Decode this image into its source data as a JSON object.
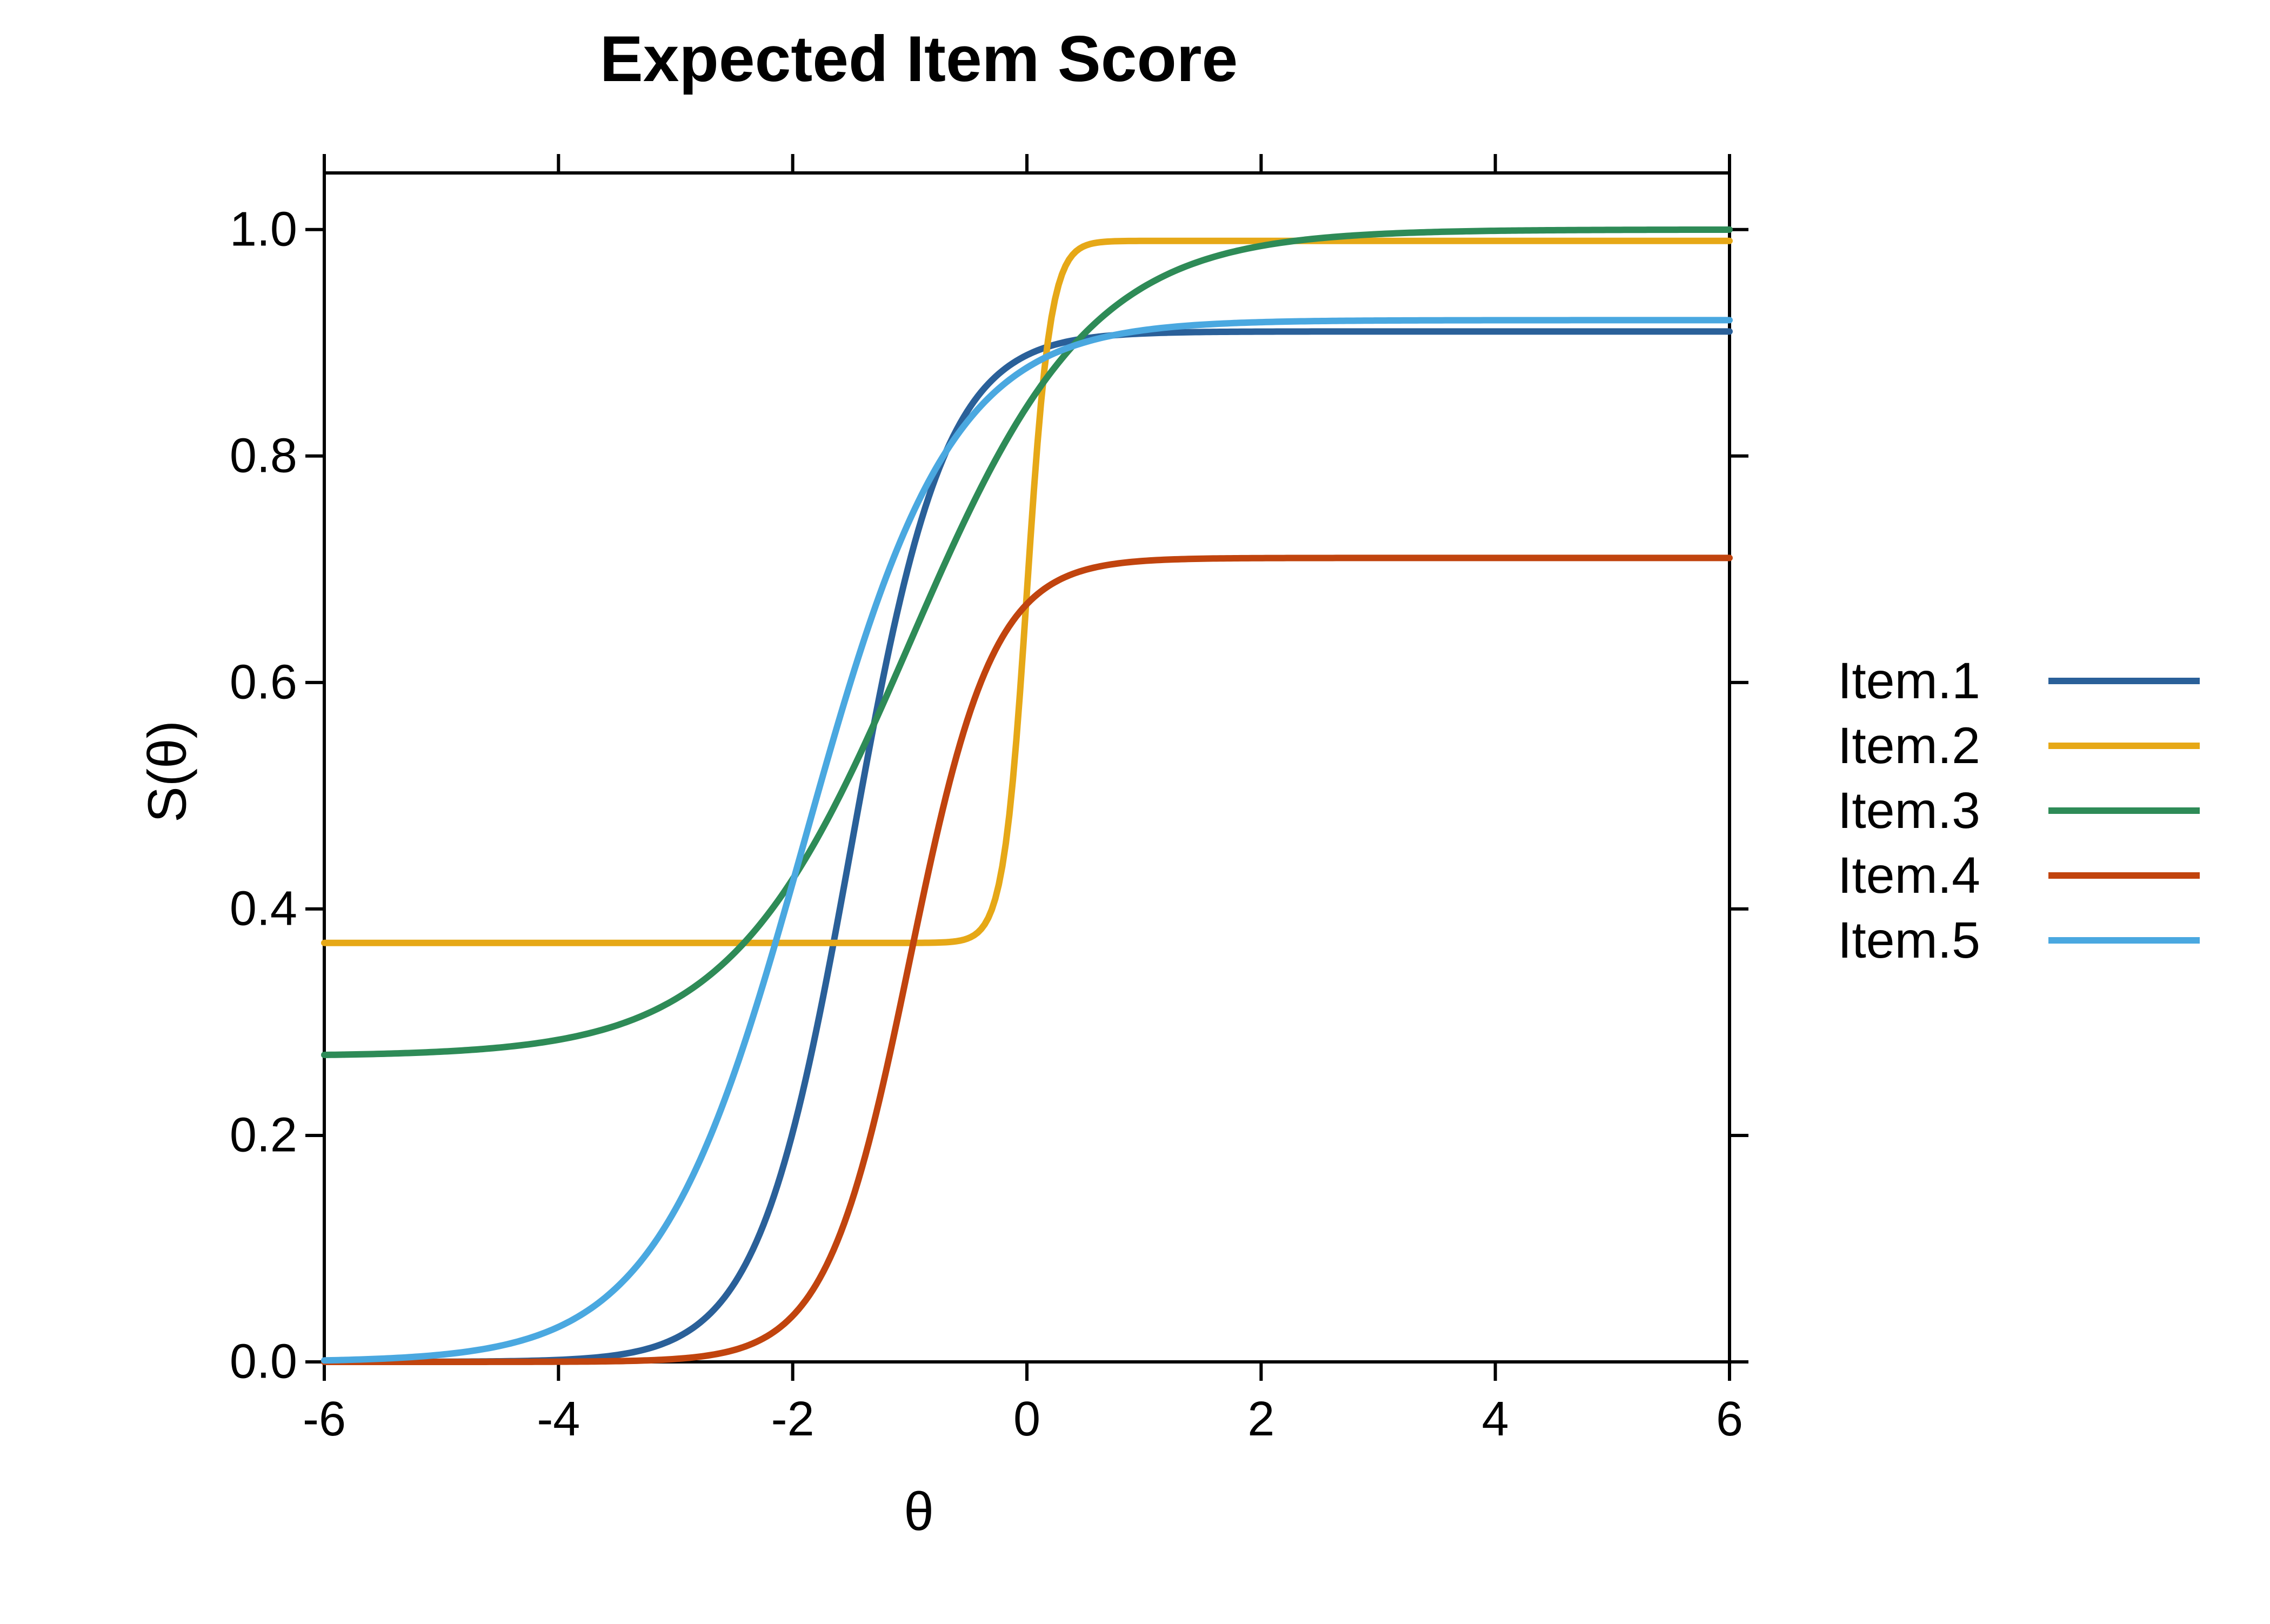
{
  "chart_data": {
    "type": "line",
    "title": "Expected Item Score",
    "xlabel": "θ",
    "ylabel": "S(θ)",
    "xlim": [
      -6,
      6
    ],
    "ylim": [
      0,
      1.05
    ],
    "xticks": [
      -6,
      -4,
      -2,
      0,
      2,
      4,
      6
    ],
    "yticks": [
      0.0,
      0.2,
      0.4,
      0.6,
      0.8,
      1.0
    ],
    "x": [
      -6.0,
      -5.5,
      -5.0,
      -4.5,
      -4.0,
      -3.5,
      -3.0,
      -2.5,
      -2.0,
      -1.5,
      -1.0,
      -0.5,
      0.0,
      0.5,
      1.0,
      1.5,
      2.0,
      2.5,
      3.0,
      3.5,
      4.0,
      4.5,
      5.0,
      5.5,
      6.0
    ],
    "series": [
      {
        "name": "Item.1",
        "color": "#2a6099",
        "params": {
          "a": 2.5,
          "b": -1.5,
          "c": 0.0,
          "d": 0.91
        },
        "values": [
          0.0,
          0.0,
          0.001,
          0.002,
          0.005,
          0.019,
          0.062,
          0.182,
          0.417,
          0.687,
          0.835,
          0.888,
          0.903,
          0.908,
          0.909,
          0.91,
          0.91,
          0.91,
          0.91,
          0.91,
          0.91,
          0.91,
          0.91,
          0.91,
          0.91
        ]
      },
      {
        "name": "Item.2",
        "color": "#e6a817",
        "params": {
          "a": 10.0,
          "b": 0.0,
          "c": 0.37,
          "d": 0.99
        },
        "values": [
          0.37,
          0.37,
          0.37,
          0.37,
          0.37,
          0.37,
          0.37,
          0.37,
          0.37,
          0.37,
          0.37,
          0.374,
          0.68,
          0.986,
          0.99,
          0.99,
          0.99,
          0.99,
          0.99,
          0.99,
          0.99,
          0.99,
          0.99,
          0.99,
          0.99
        ]
      },
      {
        "name": "Item.3",
        "color": "#2e8b57",
        "params": {
          "a": 1.3,
          "b": -1.0,
          "c": 0.27,
          "d": 1.0
        },
        "values": [
          0.271,
          0.272,
          0.274,
          0.277,
          0.285,
          0.298,
          0.323,
          0.367,
          0.44,
          0.547,
          0.67,
          0.782,
          0.863,
          0.917,
          0.95,
          0.97,
          0.983,
          0.99,
          0.994,
          0.997,
          0.998,
          0.999,
          0.999,
          1.0,
          1.0
        ]
      },
      {
        "name": "Item.4",
        "color": "#c1440e",
        "params": {
          "a": 2.8,
          "b": -1.0,
          "c": 0.0,
          "d": 0.71
        },
        "values": [
          0.0,
          0.0,
          0.0,
          0.0,
          0.002,
          0.006,
          0.026,
          0.093,
          0.264,
          0.486,
          0.631,
          0.69,
          0.705,
          0.709,
          0.71,
          0.71,
          0.71,
          0.71,
          0.71,
          0.71,
          0.71,
          0.71,
          0.71,
          0.71,
          0.71
        ]
      },
      {
        "name": "Item.5",
        "color": "#4aa8e0",
        "params": {
          "a": 1.6,
          "b": -1.9,
          "c": 0.0,
          "d": 0.92
        },
        "values": [
          0.001,
          0.003,
          0.006,
          0.014,
          0.031,
          0.067,
          0.138,
          0.258,
          0.419,
          0.592,
          0.73,
          0.821,
          0.872,
          0.898,
          0.91,
          0.916,
          0.918,
          0.919,
          0.92,
          0.92,
          0.92,
          0.92,
          0.92,
          0.92,
          0.92
        ]
      }
    ],
    "legend_position": "right"
  }
}
